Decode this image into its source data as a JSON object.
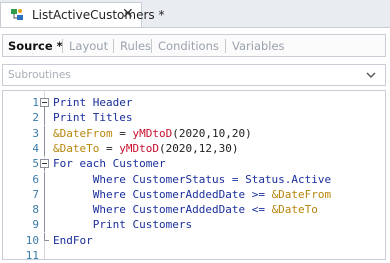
{
  "window": {
    "tab_title": "ListActiveCustomers *",
    "close_glyph": "✕"
  },
  "subtabs": [
    {
      "label": "Source *",
      "active": true
    },
    {
      "label": "Layout",
      "active": false
    },
    {
      "label": "Rules",
      "active": false
    },
    {
      "label": "Conditions",
      "active": false
    },
    {
      "label": "Variables",
      "active": false
    }
  ],
  "dropdown": {
    "value": "Subroutines",
    "icon": "chevron-down-icon"
  },
  "editor": {
    "lines": [
      {
        "num": "1",
        "fold": "minus",
        "parts": [
          [
            "kw",
            "Print Header"
          ]
        ]
      },
      {
        "num": "2",
        "fold": "line",
        "parts": [
          [
            "kw",
            "Print Titles"
          ]
        ]
      },
      {
        "num": "3",
        "fold": "line",
        "parts": [
          [
            "var",
            "&DateFrom"
          ],
          [
            "plain",
            " = "
          ],
          [
            "fn",
            "yMDtoD"
          ],
          [
            "plain",
            "(2020,10,20)"
          ]
        ]
      },
      {
        "num": "4",
        "fold": "line",
        "parts": [
          [
            "var",
            "&DateTo"
          ],
          [
            "plain",
            " = "
          ],
          [
            "fn",
            "yMDtoD"
          ],
          [
            "plain",
            "(2020,12,30)"
          ]
        ]
      },
      {
        "num": "5",
        "fold": "minus",
        "parts": [
          [
            "kw",
            "For each Customer"
          ]
        ]
      },
      {
        "num": "6",
        "fold": "line",
        "parts": [
          [
            "plain",
            "      "
          ],
          [
            "kw",
            "Where CustomerStatus = Status.Active"
          ]
        ]
      },
      {
        "num": "7",
        "fold": "line",
        "parts": [
          [
            "plain",
            "      "
          ],
          [
            "kw",
            "Where CustomerAddedDate >= "
          ],
          [
            "var",
            "&DateFrom"
          ]
        ]
      },
      {
        "num": "8",
        "fold": "line",
        "parts": [
          [
            "plain",
            "      "
          ],
          [
            "kw",
            "Where CustomerAddedDate <= "
          ],
          [
            "var",
            "&DateTo"
          ]
        ]
      },
      {
        "num": "9",
        "fold": "line",
        "parts": [
          [
            "plain",
            "      "
          ],
          [
            "kw",
            "Print Customers"
          ]
        ]
      },
      {
        "num": "10",
        "fold": "end",
        "parts": [
          [
            "kw",
            "EndFor"
          ]
        ]
      },
      {
        "num": "11",
        "fold": "none",
        "parts": []
      }
    ]
  },
  "colors": {
    "keyword": "#1a2f9c",
    "variable": "#b8860b",
    "function": "#c8102e",
    "line_number": "#3a7ba8"
  }
}
